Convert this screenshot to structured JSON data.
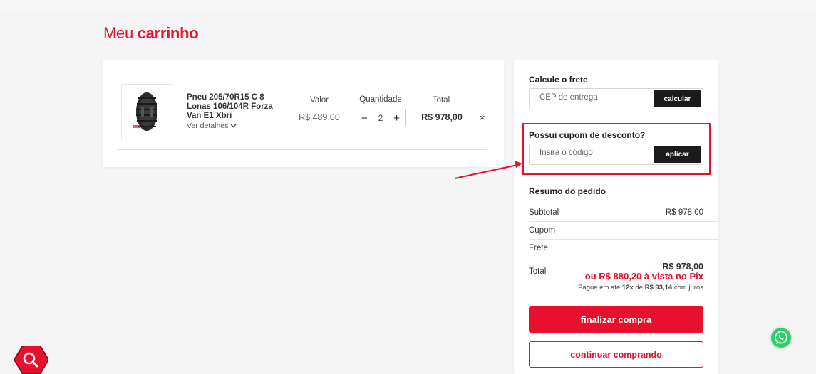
{
  "page": {
    "title_prefix": "Meu",
    "title_bold": "carrinho"
  },
  "cart": {
    "columns": {
      "value": "Valor",
      "quantity": "Quantidade",
      "total": "Total"
    },
    "items": [
      {
        "name": "Pneu 205/70R15 C 8 Lonas 106/104R Forza Van E1 Xbri",
        "details_label": "Ver detalhes",
        "price": "R$ 489,00",
        "quantity": "2",
        "total": "R$ 978,00",
        "remove_glyph": "×",
        "minus_glyph": "−",
        "plus_glyph": "+"
      }
    ]
  },
  "shipping": {
    "title": "Calcule o frete",
    "placeholder": "CEP de entrega",
    "button": "calcular"
  },
  "coupon": {
    "title": "Possui cupom de desconto?",
    "placeholder": "Insira o código",
    "button": "aplicar"
  },
  "summary": {
    "title": "Resumo do pedido",
    "subtotal_label": "Subtotal",
    "subtotal_value": "R$ 978,00",
    "coupon_label": "Cupom",
    "shipping_label": "Frete",
    "total_label": "Total",
    "total_value": "R$ 978,00",
    "pix_text": "ou R$ 880,20 à vista no Pix",
    "installments_prefix": "Pague em até",
    "installments_count": "12x",
    "installments_mid": "de",
    "installments_value": "R$ 93,14",
    "installments_suffix": "com juros"
  },
  "actions": {
    "checkout": "finalizar compra",
    "continue": "continuar comprando"
  },
  "colors": {
    "brand_red": "#e8112d",
    "dark_button": "#1b1b1b",
    "whatsapp_green": "#25d366"
  },
  "icons": {
    "whatsapp": "whatsapp-icon",
    "search": "search-icon",
    "chevron": "chevron-down-icon"
  }
}
